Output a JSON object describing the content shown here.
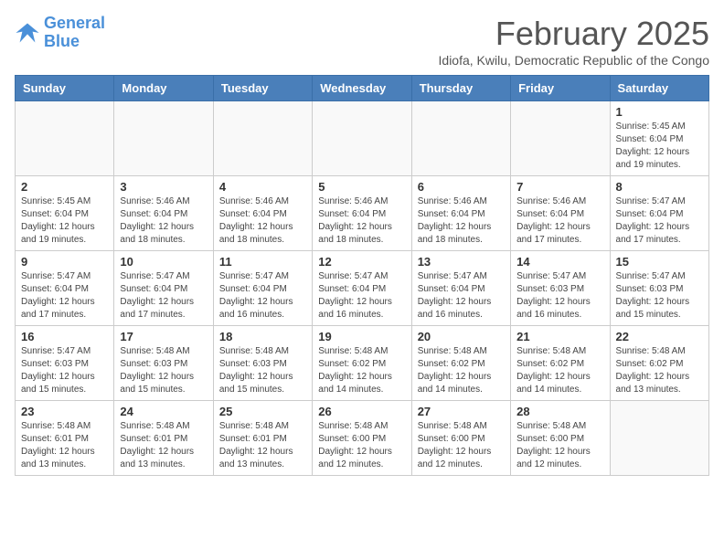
{
  "logo": {
    "line1": "General",
    "line2": "Blue"
  },
  "title": "February 2025",
  "subtitle": "Idiofa, Kwilu, Democratic Republic of the Congo",
  "headers": [
    "Sunday",
    "Monday",
    "Tuesday",
    "Wednesday",
    "Thursday",
    "Friday",
    "Saturday"
  ],
  "weeks": [
    [
      {
        "day": "",
        "info": ""
      },
      {
        "day": "",
        "info": ""
      },
      {
        "day": "",
        "info": ""
      },
      {
        "day": "",
        "info": ""
      },
      {
        "day": "",
        "info": ""
      },
      {
        "day": "",
        "info": ""
      },
      {
        "day": "1",
        "info": "Sunrise: 5:45 AM\nSunset: 6:04 PM\nDaylight: 12 hours\nand 19 minutes."
      }
    ],
    [
      {
        "day": "2",
        "info": "Sunrise: 5:45 AM\nSunset: 6:04 PM\nDaylight: 12 hours\nand 19 minutes."
      },
      {
        "day": "3",
        "info": "Sunrise: 5:46 AM\nSunset: 6:04 PM\nDaylight: 12 hours\nand 18 minutes."
      },
      {
        "day": "4",
        "info": "Sunrise: 5:46 AM\nSunset: 6:04 PM\nDaylight: 12 hours\nand 18 minutes."
      },
      {
        "day": "5",
        "info": "Sunrise: 5:46 AM\nSunset: 6:04 PM\nDaylight: 12 hours\nand 18 minutes."
      },
      {
        "day": "6",
        "info": "Sunrise: 5:46 AM\nSunset: 6:04 PM\nDaylight: 12 hours\nand 18 minutes."
      },
      {
        "day": "7",
        "info": "Sunrise: 5:46 AM\nSunset: 6:04 PM\nDaylight: 12 hours\nand 17 minutes."
      },
      {
        "day": "8",
        "info": "Sunrise: 5:47 AM\nSunset: 6:04 PM\nDaylight: 12 hours\nand 17 minutes."
      }
    ],
    [
      {
        "day": "9",
        "info": "Sunrise: 5:47 AM\nSunset: 6:04 PM\nDaylight: 12 hours\nand 17 minutes."
      },
      {
        "day": "10",
        "info": "Sunrise: 5:47 AM\nSunset: 6:04 PM\nDaylight: 12 hours\nand 17 minutes."
      },
      {
        "day": "11",
        "info": "Sunrise: 5:47 AM\nSunset: 6:04 PM\nDaylight: 12 hours\nand 16 minutes."
      },
      {
        "day": "12",
        "info": "Sunrise: 5:47 AM\nSunset: 6:04 PM\nDaylight: 12 hours\nand 16 minutes."
      },
      {
        "day": "13",
        "info": "Sunrise: 5:47 AM\nSunset: 6:04 PM\nDaylight: 12 hours\nand 16 minutes."
      },
      {
        "day": "14",
        "info": "Sunrise: 5:47 AM\nSunset: 6:03 PM\nDaylight: 12 hours\nand 16 minutes."
      },
      {
        "day": "15",
        "info": "Sunrise: 5:47 AM\nSunset: 6:03 PM\nDaylight: 12 hours\nand 15 minutes."
      }
    ],
    [
      {
        "day": "16",
        "info": "Sunrise: 5:47 AM\nSunset: 6:03 PM\nDaylight: 12 hours\nand 15 minutes."
      },
      {
        "day": "17",
        "info": "Sunrise: 5:48 AM\nSunset: 6:03 PM\nDaylight: 12 hours\nand 15 minutes."
      },
      {
        "day": "18",
        "info": "Sunrise: 5:48 AM\nSunset: 6:03 PM\nDaylight: 12 hours\nand 15 minutes."
      },
      {
        "day": "19",
        "info": "Sunrise: 5:48 AM\nSunset: 6:02 PM\nDaylight: 12 hours\nand 14 minutes."
      },
      {
        "day": "20",
        "info": "Sunrise: 5:48 AM\nSunset: 6:02 PM\nDaylight: 12 hours\nand 14 minutes."
      },
      {
        "day": "21",
        "info": "Sunrise: 5:48 AM\nSunset: 6:02 PM\nDaylight: 12 hours\nand 14 minutes."
      },
      {
        "day": "22",
        "info": "Sunrise: 5:48 AM\nSunset: 6:02 PM\nDaylight: 12 hours\nand 13 minutes."
      }
    ],
    [
      {
        "day": "23",
        "info": "Sunrise: 5:48 AM\nSunset: 6:01 PM\nDaylight: 12 hours\nand 13 minutes."
      },
      {
        "day": "24",
        "info": "Sunrise: 5:48 AM\nSunset: 6:01 PM\nDaylight: 12 hours\nand 13 minutes."
      },
      {
        "day": "25",
        "info": "Sunrise: 5:48 AM\nSunset: 6:01 PM\nDaylight: 12 hours\nand 13 minutes."
      },
      {
        "day": "26",
        "info": "Sunrise: 5:48 AM\nSunset: 6:00 PM\nDaylight: 12 hours\nand 12 minutes."
      },
      {
        "day": "27",
        "info": "Sunrise: 5:48 AM\nSunset: 6:00 PM\nDaylight: 12 hours\nand 12 minutes."
      },
      {
        "day": "28",
        "info": "Sunrise: 5:48 AM\nSunset: 6:00 PM\nDaylight: 12 hours\nand 12 minutes."
      },
      {
        "day": "",
        "info": ""
      }
    ]
  ]
}
